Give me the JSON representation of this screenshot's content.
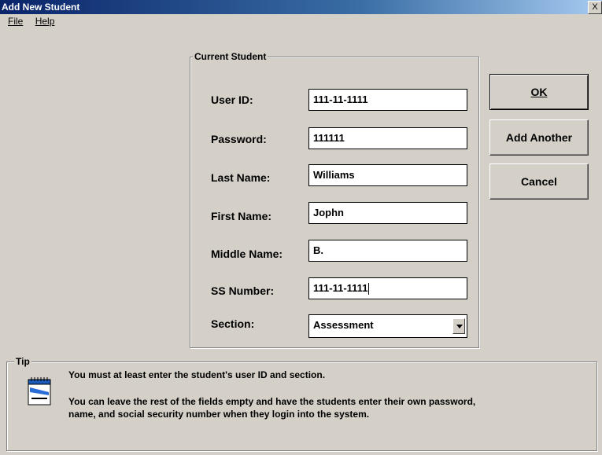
{
  "window": {
    "title": "Add New Student",
    "close_label": "X"
  },
  "menu": {
    "file": "File",
    "help": "Help"
  },
  "group": {
    "title": "Current Student"
  },
  "fields": [
    {
      "label": "User ID:",
      "value": "111-11-1111"
    },
    {
      "label": "Password:",
      "value": "111111"
    },
    {
      "label": "Last Name:",
      "value": "Williams"
    },
    {
      "label": "First Name:",
      "value": "Jophn"
    },
    {
      "label": "Middle Name:",
      "value": "B."
    },
    {
      "label": "SS Number:",
      "value": "111-11-1111"
    },
    {
      "label": "Section:",
      "value": "Assessment"
    }
  ],
  "buttons": {
    "ok": "OK",
    "add_another": "Add Another",
    "cancel": "Cancel"
  },
  "tip": {
    "title": "Tip",
    "line1": "You must at least enter the student's user ID and section.",
    "line2": "You can leave the rest of the fields empty and have the students enter their own password,",
    "line3": "name, and social security number when they login into the system.",
    "icon": "notepad-icon"
  }
}
